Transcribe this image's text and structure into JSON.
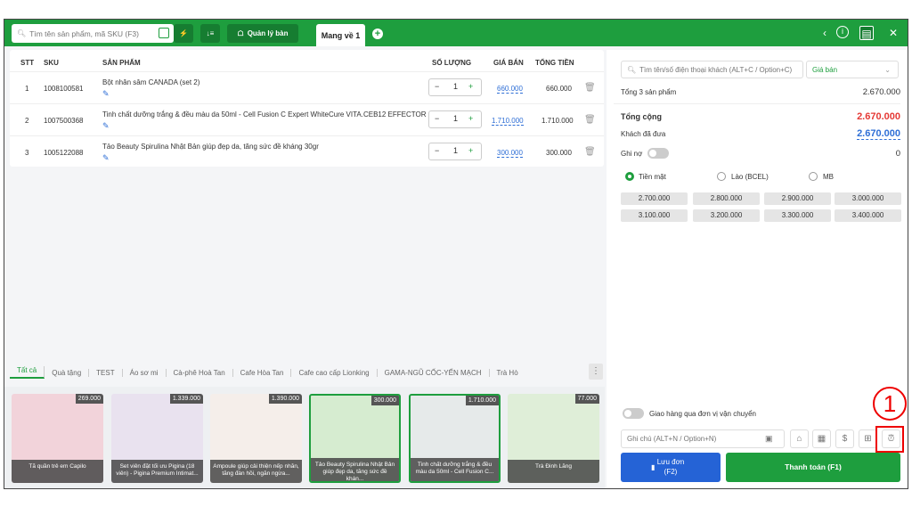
{
  "topbar": {
    "search_placeholder": "Tìm tên sản phẩm, mã SKU (F3)",
    "manage_label": "Quản lý bàn",
    "tab_label": "Mang về 1"
  },
  "table": {
    "headers": {
      "stt": "STT",
      "sku": "SKU",
      "product": "SẢN PHẨM",
      "qty": "SỐ LƯỢNG",
      "price": "GIÁ BÁN",
      "total": "TỔNG TIỀN"
    },
    "rows": [
      {
        "stt": "1",
        "sku": "1008100581",
        "name": "Bột nhân sâm CANADA (set 2)",
        "qty": "1",
        "price": "660.000",
        "total": "660.000"
      },
      {
        "stt": "2",
        "sku": "1007500368",
        "name": "Tinh chất dưỡng trắng & đều màu da 50ml - Cell Fusion C Expert WhiteCure VITA.CEB12 EFFECTOR",
        "qty": "1",
        "price": "1.710.000",
        "total": "1.710.000"
      },
      {
        "stt": "3",
        "sku": "1005122088",
        "name": "Tảo Beauty Spirulina Nhật Bản giúp đẹp da, tăng sức đề kháng 30gr",
        "qty": "1",
        "price": "300.000",
        "total": "300.000"
      }
    ]
  },
  "categories": [
    "Tất cả",
    "Quà tặng",
    "TEST",
    "Áo sơ mi",
    "Cà-phê Hoà Tan",
    "Cafe Hòa Tan",
    "Cafe cao cấp Lionking",
    "GAMA-NGŨ CỐC-YẾN MẠCH",
    "Trà Hò"
  ],
  "products": [
    {
      "price": "269.000",
      "name": "Tã quần trẻ em Capilo"
    },
    {
      "price": "1.339.000",
      "name": "Set viên đặt tối ưu Pigina (18 viên) - Pigina Premium Intimat..."
    },
    {
      "price": "1.390.000",
      "name": "Ampoule giúp cải thiện nếp nhăn, tăng đàn hồi, ngăn ngừa..."
    },
    {
      "price": "300.000",
      "name": "Tảo Beauty Spirulina Nhật Bản giúp đẹp da, tăng sức đề khán..."
    },
    {
      "price": "1.710.000",
      "name": "Tinh chất dưỡng trắng & đều màu da 50ml - Cell Fusion C..."
    },
    {
      "price": "77.000",
      "name": "Trà Đinh Lăng"
    }
  ],
  "right": {
    "customer_placeholder": "Tìm tên/số điện thoại khách (ALT+C / Option+C)",
    "price_select": "Giá bán",
    "summary_label": "Tổng 3 sản phẩm",
    "summary_value": "2.670.000",
    "total_label": "Tổng cộng",
    "total_value": "2.670.000",
    "paid_label": "Khách đã đưa",
    "paid_value": "2.670.000",
    "debt_label": "Ghi nợ",
    "debt_value": "0",
    "methods": [
      "Tiền mặt",
      "Lào (BCEL)",
      "MB"
    ],
    "amounts": [
      "2.700.000",
      "2.800.000",
      "2.900.000",
      "3.000.000",
      "3.100.000",
      "3.200.000",
      "3.300.000",
      "3.400.000"
    ],
    "shipping_label": "Giao hàng qua đơn vị vận chuyển",
    "note_placeholder": "Ghi chú (ALT+N / Option+N)",
    "save_label": "Lưu đơn",
    "save_key": "(F2)",
    "pay_label": "Thanh toán (F1)"
  },
  "annotation": {
    "marker": "1"
  },
  "colors": {
    "brand": "#1e9e3e",
    "link": "#2f6fd6",
    "total": "#e53935",
    "save": "#2563d6",
    "highlight": "#ee0000"
  }
}
